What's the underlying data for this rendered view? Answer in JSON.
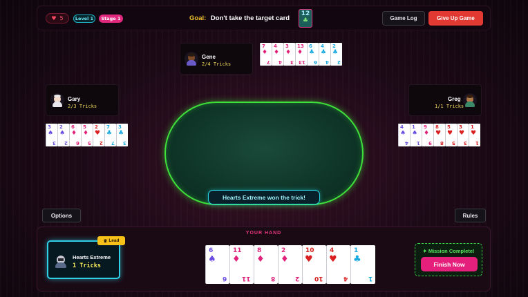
{
  "header": {
    "lives": "5",
    "level": "Level 1",
    "stage": "Stage 1",
    "goal_label": "Goal:",
    "goal_text": "Don't take the target card",
    "target_card": {
      "rank": "12",
      "suit": "♣",
      "icon": "club-icon"
    },
    "game_log_label": "Game Log",
    "give_up_label": "Give Up Game"
  },
  "players": {
    "gene": {
      "name": "Gene",
      "tricks": "2/4 Tricks"
    },
    "gary": {
      "name": "Gary",
      "tricks": "2/3 Tricks"
    },
    "greg": {
      "name": "Greg",
      "tricks": "1/1 Tricks"
    }
  },
  "hands": {
    "gene": [
      {
        "rank": "7",
        "suit": "♦",
        "color": "#e0217a"
      },
      {
        "rank": "4",
        "suit": "♦",
        "color": "#e0217a"
      },
      {
        "rank": "3",
        "suit": "♦",
        "color": "#e0217a"
      },
      {
        "rank": "13",
        "suit": "♦",
        "color": "#e0217a"
      },
      {
        "rank": "6",
        "suit": "♣",
        "color": "#18a8e0"
      },
      {
        "rank": "4",
        "suit": "♣",
        "color": "#18a8e0"
      },
      {
        "rank": "2",
        "suit": "♣",
        "color": "#18a8e0"
      }
    ],
    "gary": [
      {
        "rank": "3",
        "suit": "♠",
        "color": "#6a4ce0"
      },
      {
        "rank": "2",
        "suit": "♠",
        "color": "#6a4ce0"
      },
      {
        "rank": "6",
        "suit": "♦",
        "color": "#e0217a"
      },
      {
        "rank": "5",
        "suit": "♦",
        "color": "#e0217a"
      },
      {
        "rank": "2",
        "suit": "♥",
        "color": "#d82020"
      },
      {
        "rank": "7",
        "suit": "♣",
        "color": "#18a8e0"
      },
      {
        "rank": "3",
        "suit": "♣",
        "color": "#18a8e0"
      }
    ],
    "greg": [
      {
        "rank": "4",
        "suit": "♠",
        "color": "#6a4ce0"
      },
      {
        "rank": "1",
        "suit": "♠",
        "color": "#6a4ce0"
      },
      {
        "rank": "9",
        "suit": "♦",
        "color": "#e0217a"
      },
      {
        "rank": "8",
        "suit": "♥",
        "color": "#d82020"
      },
      {
        "rank": "5",
        "suit": "♥",
        "color": "#d82020"
      },
      {
        "rank": "3",
        "suit": "♥",
        "color": "#d82020"
      },
      {
        "rank": "1",
        "suit": "♥",
        "color": "#d82020"
      }
    ],
    "mine": [
      {
        "rank": "6",
        "suit": "♠",
        "color": "#6a4ce0"
      },
      {
        "rank": "11",
        "suit": "♦",
        "color": "#e0217a"
      },
      {
        "rank": "8",
        "suit": "♦",
        "color": "#e0217a"
      },
      {
        "rank": "2",
        "suit": "♦",
        "color": "#e0217a"
      },
      {
        "rank": "10",
        "suit": "♥",
        "color": "#d82020"
      },
      {
        "rank": "4",
        "suit": "♥",
        "color": "#d82020"
      },
      {
        "rank": "1",
        "suit": "♣",
        "color": "#18a8e0"
      }
    ]
  },
  "table": {
    "message": "Hearts Extreme won the trick!"
  },
  "controls": {
    "options_label": "Options",
    "rules_label": "Rules"
  },
  "me": {
    "section_label": "YOUR HAND",
    "name": "Hearts Extreme",
    "tricks": "1 Tricks",
    "lead_badge": "Lead",
    "mission_label": "Mission Complete!",
    "finish_label": "Finish Now"
  },
  "colors": {
    "accent_pink": "#e51f7c",
    "accent_cyan": "#2fd0e8",
    "table_green": "#3fe03a",
    "gold": "#f2c12e",
    "danger": "#e23a32"
  }
}
